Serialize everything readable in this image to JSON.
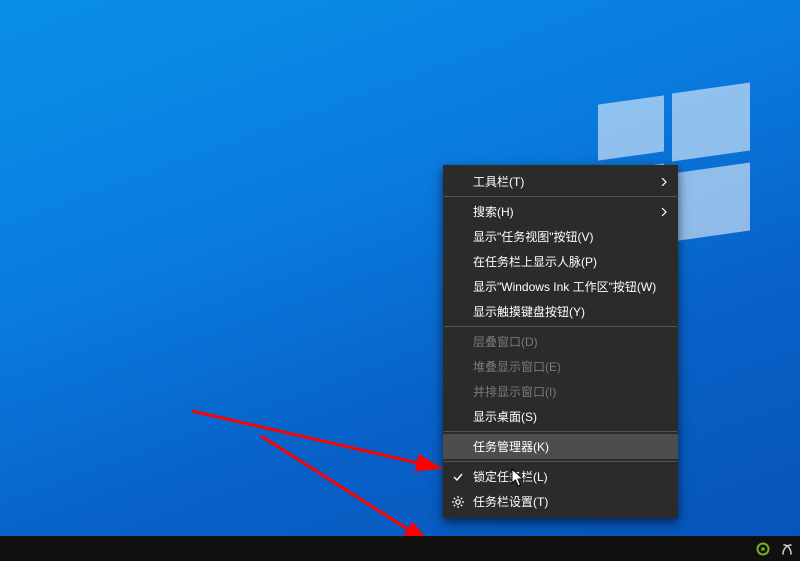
{
  "menu": {
    "toolbars": "工具栏(T)",
    "search": "搜索(H)",
    "show_taskview": "显示\"任务视图\"按钮(V)",
    "show_people": "在任务栏上显示人脉(P)",
    "show_ink": "显示\"Windows Ink 工作区\"按钮(W)",
    "show_touchkb": "显示触摸键盘按钮(Y)",
    "cascade": "层叠窗口(D)",
    "stack": "堆叠显示窗口(E)",
    "sidebyside": "并排显示窗口(I)",
    "show_desktop": "显示桌面(S)",
    "task_manager": "任务管理器(K)",
    "lock_taskbar": "锁定任务栏(L)",
    "taskbar_settings": "任务栏设置(T)"
  },
  "tray": {
    "nvidia": "nvidia-icon",
    "ime": "ime-icon"
  }
}
